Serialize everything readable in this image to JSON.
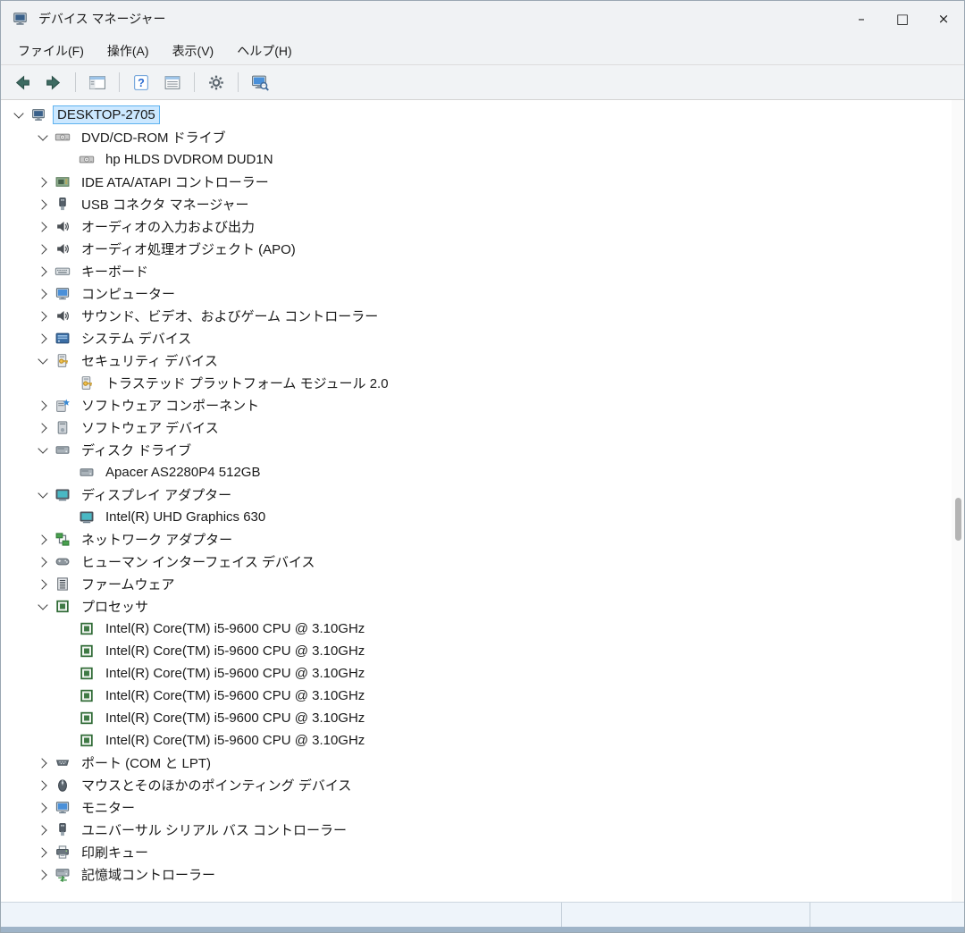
{
  "window": {
    "title": "デバイス マネージャー",
    "controls": {
      "minimize": "–",
      "maximize": "□",
      "close": "×"
    }
  },
  "colors": {
    "selection_background": "#cce8ff",
    "selection_border": "#5fb2ef",
    "processor_green": "#3f7a45",
    "security_key_yellow": "#f2c14e"
  },
  "menubar": {
    "items": [
      {
        "id": "file",
        "label": "ファイル(F)"
      },
      {
        "id": "action",
        "label": "操作(A)"
      },
      {
        "id": "view",
        "label": "表示(V)"
      },
      {
        "id": "help",
        "label": "ヘルプ(H)"
      }
    ]
  },
  "toolbar": {
    "buttons": [
      {
        "type": "button",
        "name": "back-button",
        "icon": "back-arrow"
      },
      {
        "type": "button",
        "name": "forward-button",
        "icon": "forward-arrow"
      },
      {
        "type": "separator"
      },
      {
        "type": "button",
        "name": "show-console-tree-button",
        "icon": "console-tree"
      },
      {
        "type": "separator"
      },
      {
        "type": "button",
        "name": "help-button",
        "icon": "help"
      },
      {
        "type": "button",
        "name": "properties-button",
        "icon": "properties"
      },
      {
        "type": "separator"
      },
      {
        "type": "button",
        "name": "update-driver-button",
        "icon": "gear"
      },
      {
        "type": "separator"
      },
      {
        "type": "button",
        "name": "scan-hardware-changes-button",
        "icon": "scan-hardware"
      }
    ]
  },
  "tree": {
    "rows": [
      {
        "level": 0,
        "state": "expanded",
        "icon": "computer",
        "label": "DESKTOP-2705",
        "selected": true
      },
      {
        "level": 1,
        "state": "expanded",
        "icon": "dvd-drive",
        "label": "DVD/CD-ROM ドライブ"
      },
      {
        "level": 2,
        "state": "leaf",
        "icon": "dvd-drive",
        "label": "hp HLDS DVDROM DUD1N"
      },
      {
        "level": 1,
        "state": "collapsed",
        "icon": "ide-controller",
        "label": "IDE ATA/ATAPI コントローラー"
      },
      {
        "level": 1,
        "state": "collapsed",
        "icon": "usb",
        "label": "USB コネクタ マネージャー"
      },
      {
        "level": 1,
        "state": "collapsed",
        "icon": "audio",
        "label": "オーディオの入力および出力"
      },
      {
        "level": 1,
        "state": "collapsed",
        "icon": "audio",
        "label": "オーディオ処理オブジェクト (APO)"
      },
      {
        "level": 1,
        "state": "collapsed",
        "icon": "keyboard",
        "label": "キーボード"
      },
      {
        "level": 1,
        "state": "collapsed",
        "icon": "monitor",
        "label": "コンピューター"
      },
      {
        "level": 1,
        "state": "collapsed",
        "icon": "audio",
        "label": "サウンド、ビデオ、およびゲーム コントローラー"
      },
      {
        "level": 1,
        "state": "collapsed",
        "icon": "system",
        "label": "システム デバイス"
      },
      {
        "level": 1,
        "state": "expanded",
        "icon": "security",
        "label": "セキュリティ デバイス"
      },
      {
        "level": 2,
        "state": "leaf",
        "icon": "security",
        "label": "トラステッド プラットフォーム モジュール 2.0"
      },
      {
        "level": 1,
        "state": "collapsed",
        "icon": "software-component",
        "label": "ソフトウェア コンポーネント"
      },
      {
        "level": 1,
        "state": "collapsed",
        "icon": "software-device",
        "label": "ソフトウェア デバイス"
      },
      {
        "level": 1,
        "state": "expanded",
        "icon": "disk-drive",
        "label": "ディスク ドライブ"
      },
      {
        "level": 2,
        "state": "leaf",
        "icon": "disk-drive",
        "label": "Apacer AS2280P4 512GB"
      },
      {
        "level": 1,
        "state": "expanded",
        "icon": "display-adapter",
        "label": "ディスプレイ アダプター"
      },
      {
        "level": 2,
        "state": "leaf",
        "icon": "display-adapter",
        "label": "Intel(R) UHD Graphics 630"
      },
      {
        "level": 1,
        "state": "collapsed",
        "icon": "network-adapter",
        "label": "ネットワーク アダプター"
      },
      {
        "level": 1,
        "state": "collapsed",
        "icon": "hid",
        "label": "ヒューマン インターフェイス デバイス"
      },
      {
        "level": 1,
        "state": "collapsed",
        "icon": "firmware",
        "label": "ファームウェア"
      },
      {
        "level": 1,
        "state": "expanded",
        "icon": "processor",
        "label": "プロセッサ"
      },
      {
        "level": 2,
        "state": "leaf",
        "icon": "processor",
        "label": "Intel(R) Core(TM) i5-9600 CPU @ 3.10GHz"
      },
      {
        "level": 2,
        "state": "leaf",
        "icon": "processor",
        "label": "Intel(R) Core(TM) i5-9600 CPU @ 3.10GHz"
      },
      {
        "level": 2,
        "state": "leaf",
        "icon": "processor",
        "label": "Intel(R) Core(TM) i5-9600 CPU @ 3.10GHz"
      },
      {
        "level": 2,
        "state": "leaf",
        "icon": "processor",
        "label": "Intel(R) Core(TM) i5-9600 CPU @ 3.10GHz"
      },
      {
        "level": 2,
        "state": "leaf",
        "icon": "processor",
        "label": "Intel(R) Core(TM) i5-9600 CPU @ 3.10GHz"
      },
      {
        "level": 2,
        "state": "leaf",
        "icon": "processor",
        "label": "Intel(R) Core(TM) i5-9600 CPU @ 3.10GHz"
      },
      {
        "level": 1,
        "state": "collapsed",
        "icon": "ports",
        "label": "ポート (COM と LPT)"
      },
      {
        "level": 1,
        "state": "collapsed",
        "icon": "mouse",
        "label": "マウスとそのほかのポインティング デバイス"
      },
      {
        "level": 1,
        "state": "collapsed",
        "icon": "monitor",
        "label": "モニター"
      },
      {
        "level": 1,
        "state": "collapsed",
        "icon": "usb",
        "label": "ユニバーサル シリアル バス コントローラー"
      },
      {
        "level": 1,
        "state": "collapsed",
        "icon": "printer",
        "label": "印刷キュー"
      },
      {
        "level": 1,
        "state": "collapsed",
        "icon": "storage",
        "label": "記憶域コントローラー"
      }
    ]
  },
  "statusbar": {
    "sections": [
      "",
      "",
      ""
    ]
  }
}
